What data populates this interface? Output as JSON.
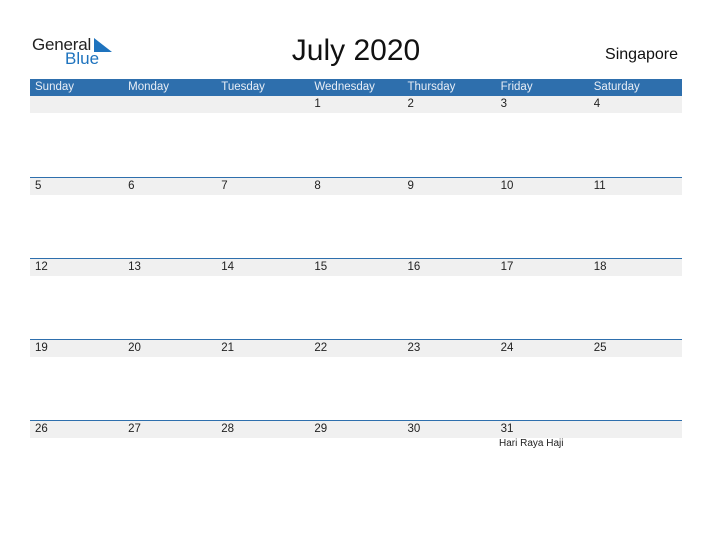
{
  "logo": {
    "line1": "General",
    "line2": "Blue"
  },
  "title": "July 2020",
  "country": "Singapore",
  "weekdays": [
    "Sunday",
    "Monday",
    "Tuesday",
    "Wednesday",
    "Thursday",
    "Friday",
    "Saturday"
  ],
  "weeks": [
    [
      "",
      "",
      "",
      "1",
      "2",
      "3",
      "4"
    ],
    [
      "5",
      "6",
      "7",
      "8",
      "9",
      "10",
      "11"
    ],
    [
      "12",
      "13",
      "14",
      "15",
      "16",
      "17",
      "18"
    ],
    [
      "19",
      "20",
      "21",
      "22",
      "23",
      "24",
      "25"
    ],
    [
      "26",
      "27",
      "28",
      "29",
      "30",
      "31",
      ""
    ]
  ],
  "holidays": [
    {
      "day": "31",
      "name": "Hari Raya Haji"
    }
  ],
  "colors": {
    "accent": "#2e6fad",
    "logo_blue": "#1e73be",
    "row_bg": "#f0f0f0"
  }
}
